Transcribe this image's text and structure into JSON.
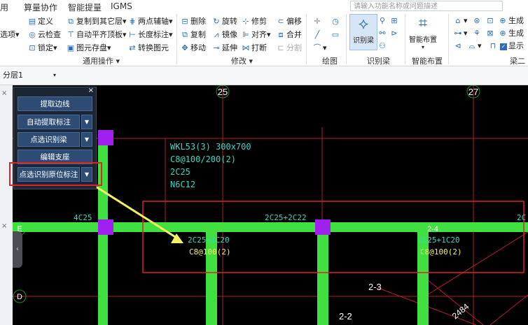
{
  "menu": {
    "items": [
      "用",
      "算量协作",
      "智能提量",
      "IGMS"
    ]
  },
  "search": {
    "placeholder": "请输入功能名称或问题描述"
  },
  "ribbon": {
    "col1": [
      "定义",
      "云检查",
      "锁定"
    ],
    "col0": [
      "选项"
    ],
    "col2": [
      "复制到其它层",
      "自动平齐顶板",
      "图元存盘"
    ],
    "col3": [
      "两点辅轴",
      "长度标注",
      "转换图元"
    ],
    "group_tongyong": "通用操作",
    "mod_col1": [
      "删除",
      "复制",
      "移动"
    ],
    "mod_col2": [
      "旋转",
      "镜像",
      "延伸"
    ],
    "mod_col3": [
      "修剪",
      "对齐",
      "打断"
    ],
    "mod_col4": [
      "偏移",
      "合并",
      "分割"
    ],
    "group_xiugai": "修改",
    "group_huitu": "绘图",
    "shibieliang": "识别梁",
    "group_shibieliang": "识别梁",
    "zhinengbuzhi": "智能布置",
    "group_zhinengbuzhi": "智能布置",
    "right_col": [
      "生成",
      "生成",
      "显示"
    ],
    "group_liang": "梁二"
  },
  "layer": {
    "value": "分层1"
  },
  "panel": {
    "buttons": [
      "提取边线",
      "自动提取标注",
      "点选识别梁",
      "编辑支座",
      "点选识别原位标注"
    ]
  },
  "cad": {
    "axis_25": "25",
    "axis_27": "27",
    "axis_E": "E",
    "axis_D": "D",
    "beam_lines": [
      "WKL53(3) 300x700",
      "C8@100/200(2)",
      "2C25",
      "N6C12"
    ],
    "label_4c25": "4C25",
    "label_top": "2C25+2C22",
    "label_2c25": "2C25+1C20",
    "label_stirrup": "C8@100(2)",
    "label_2c25_b": "2C25+1C20",
    "label_stirrup_b": "C8@100(2)",
    "label_2_4": "2-4",
    "label_2_3": "2-3",
    "label_2_2": "2-2",
    "label_2484": "2484",
    "label_right_c": "2C"
  }
}
